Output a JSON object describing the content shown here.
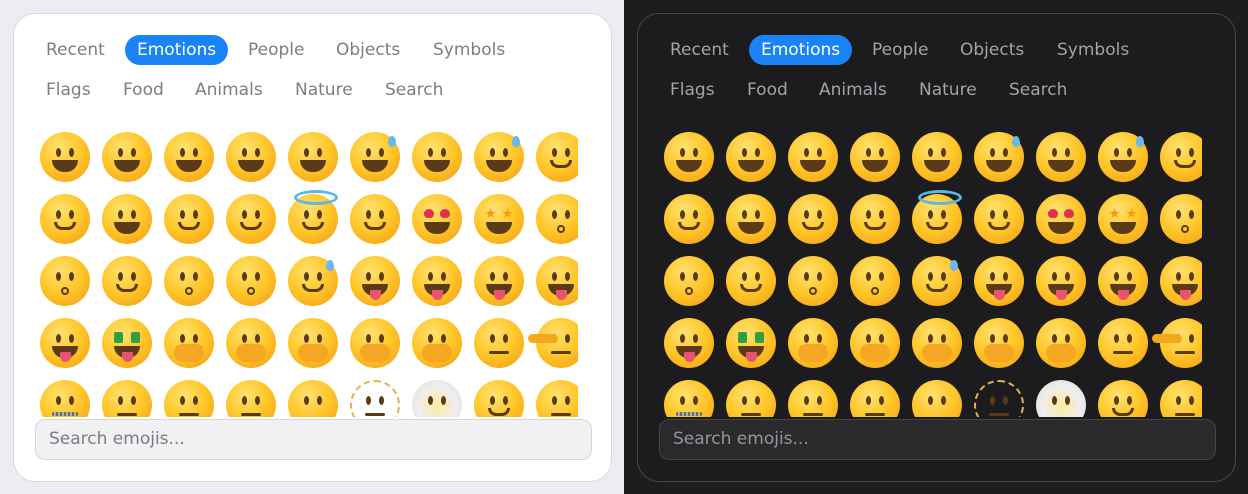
{
  "panels": [
    {
      "theme": "light",
      "tabs_row1": [
        "Recent",
        "Emotions",
        "People",
        "Objects",
        "Symbols"
      ],
      "tabs_row2": [
        "Flags",
        "Food",
        "Animals",
        "Nature",
        "Search"
      ],
      "active_tab": "Emotions",
      "search_placeholder": "Search emojis..."
    },
    {
      "theme": "dark",
      "tabs_row1": [
        "Recent",
        "Emotions",
        "People",
        "Objects",
        "Symbols"
      ],
      "tabs_row2": [
        "Flags",
        "Food",
        "Animals",
        "Nature",
        "Search"
      ],
      "active_tab": "Emotions",
      "search_placeholder": "Search emojis..."
    }
  ],
  "emoji_grid": [
    [
      "grinning-face",
      "smiling-face-big-eyes",
      "grinning-face-smiling-eyes",
      "beaming-face",
      "grinning-squinting-face",
      "grinning-face-sweat",
      "rolling-on-floor-laughing",
      "face-tears-of-joy",
      "slightly-smiling-face"
    ],
    [
      "upside-down-face",
      "melting-face",
      "winking-face",
      "smiling-face-smiling-eyes",
      "smiling-face-halo",
      "smiling-face-hearts",
      "smiling-face-heart-eyes",
      "star-struck",
      "face-blowing-kiss"
    ],
    [
      "kissing-face",
      "smiling-face",
      "kissing-face-closed-eyes",
      "kissing-face-smiling-eyes",
      "smiling-face-tear",
      "face-savoring-food",
      "face-with-tongue",
      "winking-face-tongue",
      "zany-face"
    ],
    [
      "squinting-face-tongue",
      "money-mouth-face",
      "smiling-face-open-hands",
      "face-hand-over-mouth",
      "face-open-eyes-hand-over-mouth",
      "face-peeking-eye",
      "shushing-face",
      "thinking-face",
      "saluting-face"
    ],
    [
      "zipper-mouth-face",
      "face-raised-eyebrow",
      "neutral-face",
      "expressionless-face",
      "face-without-mouth",
      "dotted-line-face",
      "face-in-clouds",
      "smirking-face",
      "unamused-face"
    ]
  ],
  "colors": {
    "accent": "#1a84f6",
    "light_bg": "#ffffff",
    "dark_bg": "#1c1c1e"
  }
}
